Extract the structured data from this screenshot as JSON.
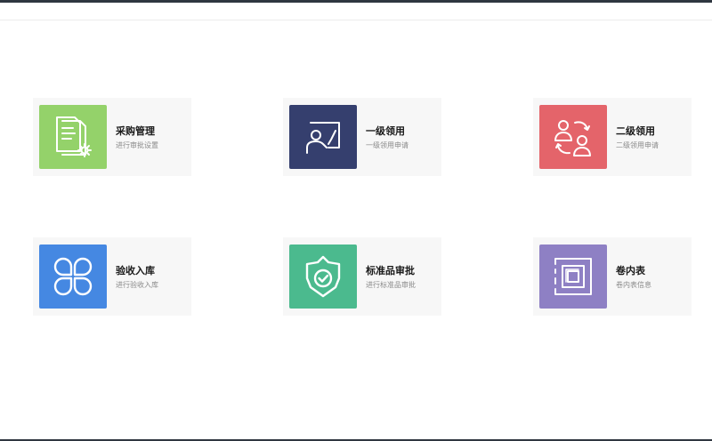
{
  "colors": {
    "topbar": "#2f3640",
    "card_background": "#f7f7f7"
  },
  "cards": [
    {
      "title": "采购管理",
      "subtitle": "进行审批设置",
      "icon": "document-settings-icon",
      "color": "#94d26a"
    },
    {
      "title": "一级领用",
      "subtitle": "一级领用申请",
      "icon": "presenter-board-icon",
      "color": "#353f6e"
    },
    {
      "title": "二级领用",
      "subtitle": "二级领用申请",
      "icon": "user-exchange-icon",
      "color": "#e4646a"
    },
    {
      "title": "验收入库",
      "subtitle": "进行验收入库",
      "icon": "four-petal-icon",
      "color": "#4588e2"
    },
    {
      "title": "标准品审批",
      "subtitle": "进行标准品审批",
      "icon": "shield-check-icon",
      "color": "#4bba8e"
    },
    {
      "title": "卷内表",
      "subtitle": "卷内表信息",
      "icon": "layered-squares-icon",
      "color": "#8e80c4"
    }
  ]
}
